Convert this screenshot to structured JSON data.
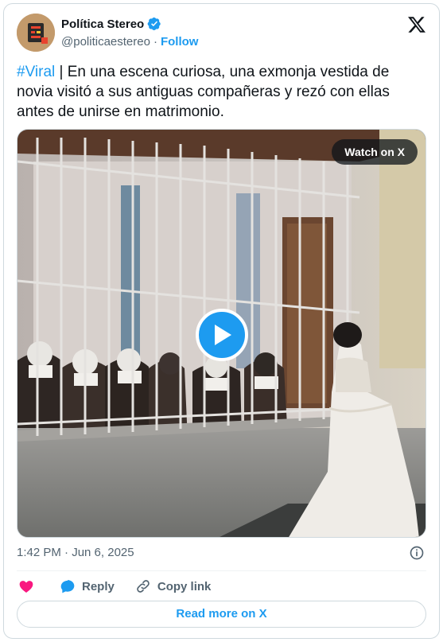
{
  "author": {
    "name": "Política Stereo",
    "handle": "@politicaestereo",
    "separator": "·",
    "follow_label": "Follow",
    "verified_icon": "verified-badge-icon",
    "avatar_icon": "politica-stereo-logo"
  },
  "platform_icon": "x-logo-icon",
  "tweet": {
    "hashtag": "#Viral",
    "text": " | En una escena curiosa, una exmonja vestida de novia visitó a sus antiguas compañeras y rezó con ellas antes de unirse en matrimonio."
  },
  "media": {
    "watch_label": "Watch on X",
    "play_icon": "play-icon"
  },
  "meta": {
    "timestamp": "1:42 PM · Jun 6, 2025",
    "info_icon": "info-icon"
  },
  "actions": {
    "like_icon": "heart-icon",
    "reply_label": "Reply",
    "reply_icon": "reply-bubble-icon",
    "copy_label": "Copy link",
    "copy_icon": "link-icon"
  },
  "read_more_label": "Read more on X",
  "colors": {
    "accent": "#1d9bf0",
    "like": "#f91880",
    "text": "#0f1419",
    "secondary": "#536471",
    "border": "#cfd9de"
  }
}
